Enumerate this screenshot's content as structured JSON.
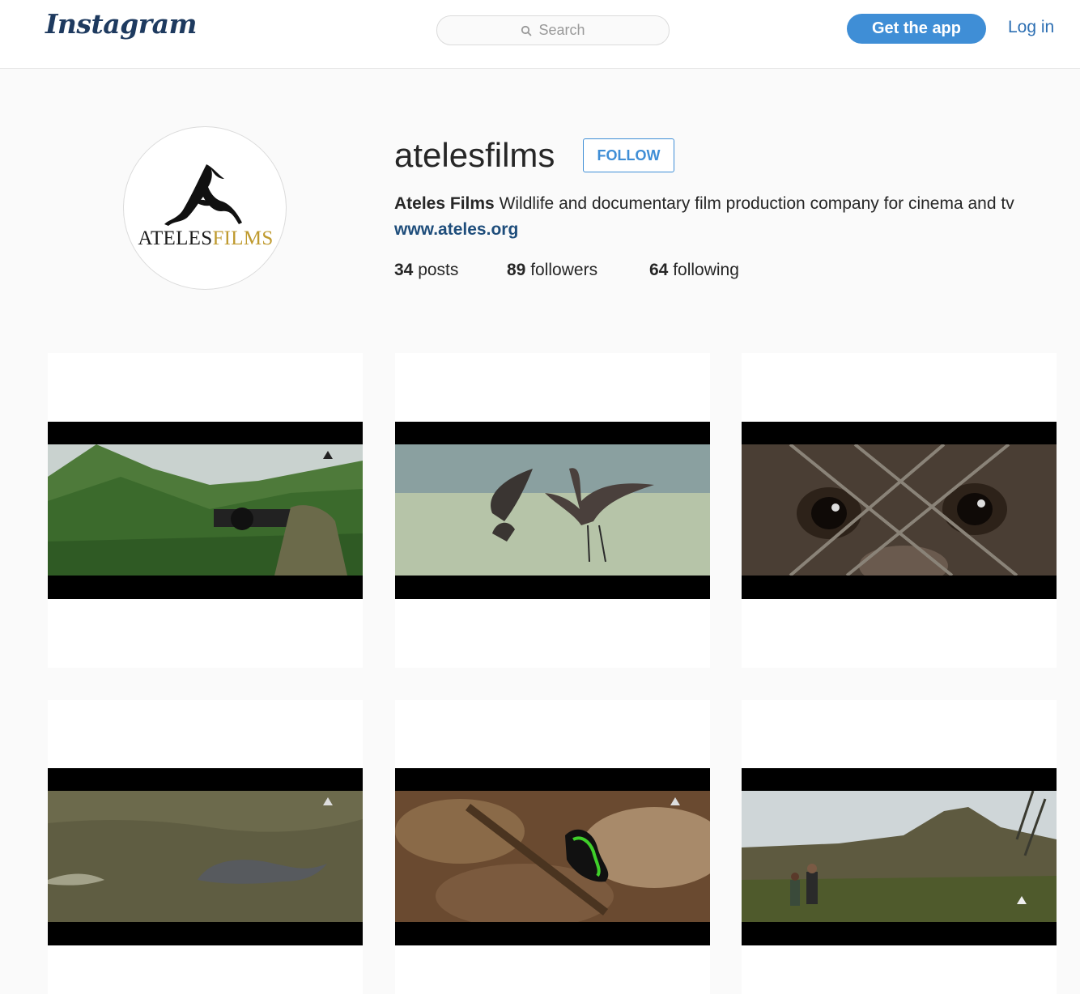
{
  "header": {
    "logo": "Instagram",
    "search_placeholder": "Search",
    "get_app_label": "Get the app",
    "login_label": "Log in"
  },
  "profile": {
    "avatar_wordmark": [
      "ATELES",
      "FILMS"
    ],
    "username": "atelesfilms",
    "follow_label": "FOLLOW",
    "full_name": "Ateles Films",
    "bio": "Wildlife and documentary film production company for cinema and tv",
    "website": "www.ateles.org",
    "stats": {
      "posts_count": "34",
      "posts_label": "posts",
      "followers_count": "89",
      "followers_label": "followers",
      "following_count": "64",
      "following_label": "following"
    }
  },
  "posts": [
    {
      "subject": "camera operator in forested mountains"
    },
    {
      "subject": "two herons on water"
    },
    {
      "subject": "chimpanzee eyes behind fence"
    },
    {
      "subject": "dolphin in river"
    },
    {
      "subject": "poison dart frog on leaves"
    },
    {
      "subject": "two people facing mountain"
    }
  ],
  "colors": {
    "accent": "#3f8ed6",
    "link": "#1e4d7b",
    "gold": "#bf9a2e"
  }
}
